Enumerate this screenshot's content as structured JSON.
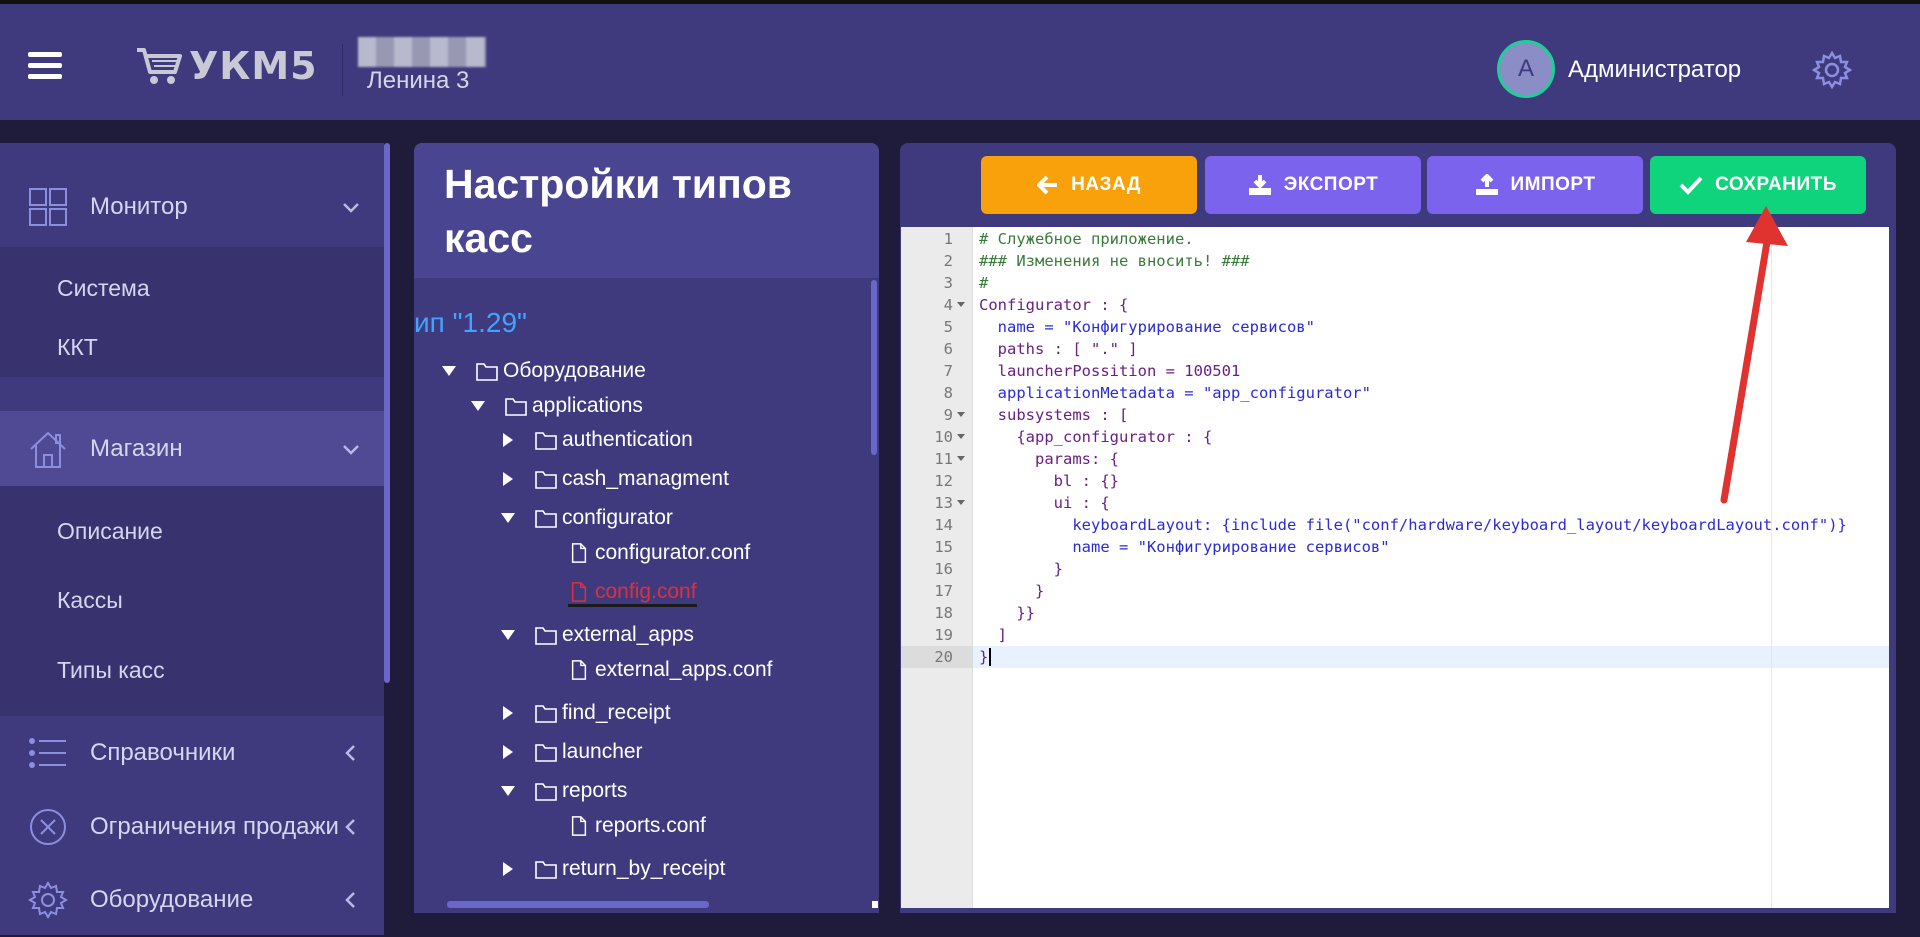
{
  "header": {
    "logo_text": "УКМ5",
    "store_name": "Ленина 3",
    "user_initial": "А",
    "user_name": "Администратор"
  },
  "sidebar": {
    "groups": [
      {
        "label": "Монитор",
        "sub": [
          "Система",
          "ККТ"
        ]
      },
      {
        "label": "Магазин",
        "sub": [
          "Описание",
          "Кассы",
          "Типы касс"
        ]
      },
      {
        "label": "Справочники"
      },
      {
        "label": "Ограничения продажи"
      },
      {
        "label": "Оборудование"
      }
    ]
  },
  "tree": {
    "title": "Настройки типов касс",
    "type_label": "ип \"1.29\"",
    "nodes": [
      {
        "label": "Оборудование",
        "kind": "folder",
        "state": "open"
      },
      {
        "label": "applications",
        "kind": "folder",
        "state": "open"
      },
      {
        "label": "authentication",
        "kind": "folder",
        "state": "closed"
      },
      {
        "label": "cash_managment",
        "kind": "folder",
        "state": "closed"
      },
      {
        "label": "configurator",
        "kind": "folder",
        "state": "open"
      },
      {
        "label": "configurator.conf",
        "kind": "file"
      },
      {
        "label": "config.conf",
        "kind": "file",
        "selected": true
      },
      {
        "label": "external_apps",
        "kind": "folder",
        "state": "open"
      },
      {
        "label": "external_apps.conf",
        "kind": "file"
      },
      {
        "label": "find_receipt",
        "kind": "folder",
        "state": "closed"
      },
      {
        "label": "launcher",
        "kind": "folder",
        "state": "closed"
      },
      {
        "label": "reports",
        "kind": "folder",
        "state": "open"
      },
      {
        "label": "reports.conf",
        "kind": "file"
      },
      {
        "label": "return_by_receipt",
        "kind": "folder",
        "state": "closed"
      }
    ]
  },
  "toolbar": {
    "back_label": "НАЗАД",
    "export_label": "ЭКСПОРТ",
    "import_label": "ИМПОРТ",
    "save_label": "СОХРАНИТЬ"
  },
  "editor": {
    "line_numbers": [
      "1",
      "2",
      "3",
      "4",
      "5",
      "6",
      "7",
      "8",
      "9",
      "10",
      "11",
      "12",
      "13",
      "14",
      "15",
      "16",
      "17",
      "18",
      "19",
      "20"
    ],
    "lines": [
      "# Служебное приложение.",
      "### Изменения не вносить! ###",
      "#",
      "Configurator : {",
      "  name = \"Конфигурирование сервисов\"",
      "  paths : [ \".\" ]",
      "  launcherPossition = 100501",
      "  applicationMetadata = \"app_configurator\"",
      "  subsystems : [",
      "    {app_configurator : {",
      "      params: {",
      "        bl : {}",
      "        ui : {",
      "          keyboardLayout: {include file(\"conf/hardware/keyboard_layout/keyboardLayout.conf\")}",
      "          name = \"Конфигурирование сервисов\"",
      "        }",
      "      }",
      "    }}",
      "  ]",
      "}"
    ]
  },
  "colors": {
    "topbar": "#3f3a7e",
    "back": "#f9a10b",
    "export": "#7c63ee",
    "save": "#10d47c",
    "arrow": "#e0332f"
  }
}
